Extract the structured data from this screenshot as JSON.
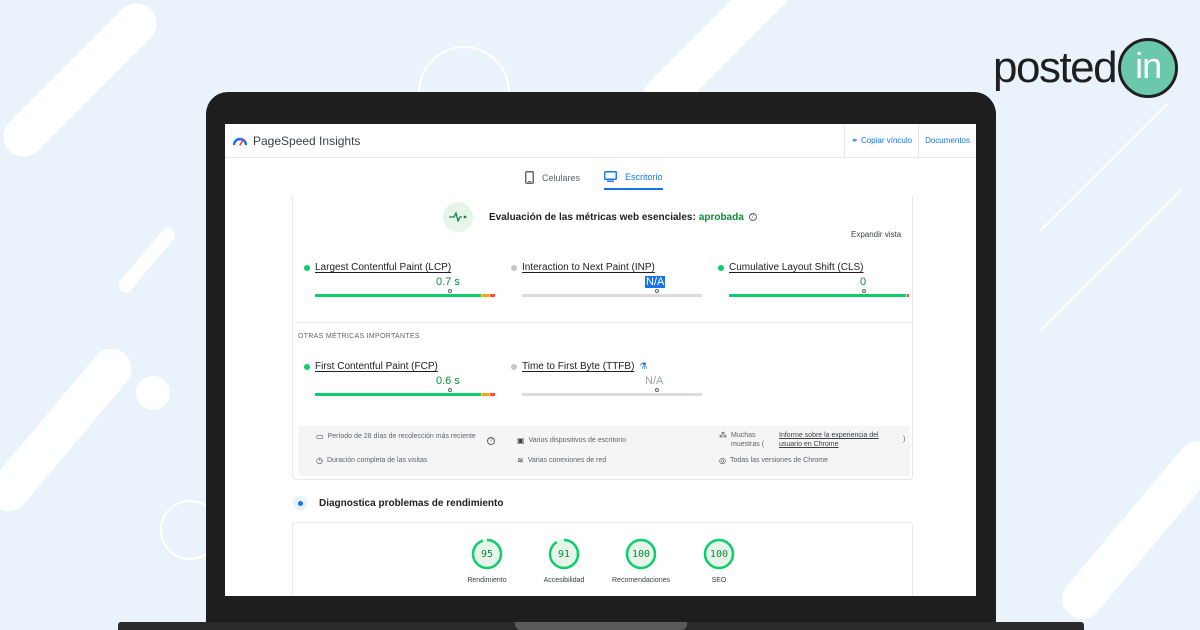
{
  "logo": {
    "word": "posted",
    "badge": "in"
  },
  "header": {
    "app_name": "PageSpeed Insights",
    "links": [
      {
        "label": "Copiar vínculo",
        "icon": "link-icon"
      },
      {
        "label": "Documentos"
      }
    ]
  },
  "tabs": [
    {
      "label": "Celulares",
      "icon": "phone-icon",
      "active": false
    },
    {
      "label": "Escritorio",
      "icon": "desktop-icon",
      "active": true
    }
  ],
  "assessment": {
    "text": "Evaluación de las métricas web esenciales:",
    "status": "aprobada"
  },
  "expand_label": "Expandir vista",
  "core_metrics": [
    {
      "name": "Largest Contentful Paint (LCP)",
      "value": "0.7 s",
      "status": "good",
      "distribution": [
        0.93,
        0.04,
        0.03
      ],
      "marker": 0.75
    },
    {
      "name": "Interaction to Next Paint (INP)",
      "value": "N/A",
      "status": "na",
      "distribution": [],
      "marker": 0.75
    },
    {
      "name": "Cumulative Layout Shift (CLS)",
      "value": "0",
      "status": "good",
      "distribution": [
        0.99,
        0.0,
        0.01
      ],
      "marker": 0.75
    }
  ],
  "other_label": "OTRAS MÉTRICAS IMPORTANTES",
  "other_metrics": [
    {
      "name": "First Contentful Paint (FCP)",
      "value": "0.6 s",
      "status": "good",
      "distribution": [
        0.93,
        0.04,
        0.03
      ],
      "marker": 0.75
    },
    {
      "name": "Time to First Byte (TTFB)",
      "value": "N/A",
      "status": "na",
      "distribution": [],
      "marker": 0.75
    }
  ],
  "info": {
    "period": "Período de 28 días de recolección más reciente",
    "duration": "Duración completa de las visitas",
    "devices": "Varios dispositivos de escritorio",
    "connections": "Varias conexiones de red",
    "samples_prefix": "Muchas muestras (",
    "samples_link": "Informe sobre la experiencia del usuario en Chrome",
    "samples_suffix": ")",
    "chrome": "Todas las versiones de Chrome"
  },
  "diagnostics": {
    "title": "Diagnostica problemas de rendimiento"
  },
  "scores": [
    {
      "label": "Rendimiento",
      "value": 95
    },
    {
      "label": "Accesibilidad",
      "value": 91
    },
    {
      "label": "Recomendaciones",
      "value": 100
    },
    {
      "label": "SEO",
      "value": 100
    }
  ],
  "colors": {
    "good": "#0cce6b",
    "average": "#ffa400",
    "poor": "#ff4e42",
    "accent": "#1a73e8",
    "logo": "#6cc8ad"
  }
}
